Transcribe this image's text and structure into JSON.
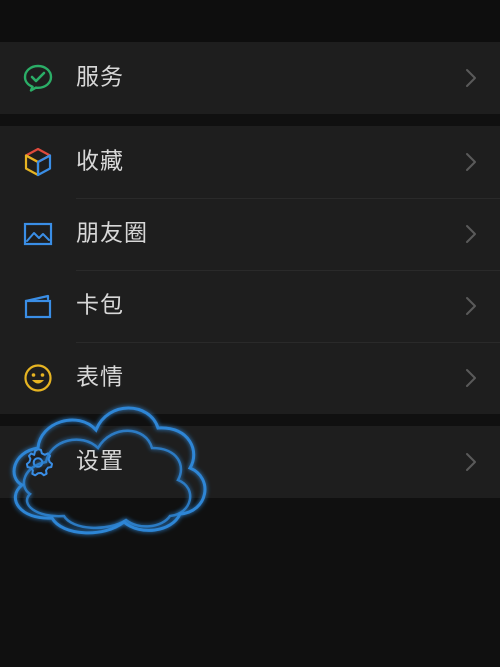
{
  "menu": {
    "services": {
      "label": "服务",
      "icon": "wechat-pay-icon",
      "color": "#2bae67"
    },
    "favorites": {
      "label": "收藏",
      "icon": "cube-icon"
    },
    "moments": {
      "label": "朋友圈",
      "icon": "image-icon",
      "color": "#3a8ee6"
    },
    "cards": {
      "label": "卡包",
      "icon": "wallet-icon",
      "color": "#3a8ee6"
    },
    "stickers": {
      "label": "表情",
      "icon": "smiley-icon",
      "color": "#e6b422"
    },
    "settings": {
      "label": "设置",
      "icon": "gear-icon",
      "color": "#3a8ee6"
    }
  },
  "colors": {
    "background": "#101010",
    "row_background": "#1e1e1e",
    "text": "#d8d8d8",
    "chevron": "#5a5a5a",
    "cloud_outline": "#2f86d6"
  }
}
